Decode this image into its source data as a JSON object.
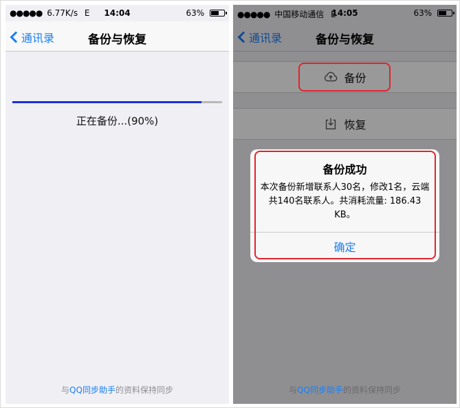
{
  "left_phone": {
    "statusbar": {
      "signal": "●●●●●",
      "speed": "6.77K/s",
      "network": "E",
      "time": "14:04",
      "battery_pct": "63%",
      "battery_level": 0.63
    },
    "nav": {
      "back_label": "通讯录",
      "title": "备份与恢复"
    },
    "progress": {
      "value": 0.9,
      "text": "正在备份...(90%)"
    },
    "footer": {
      "prefix": "与",
      "link": "QQ同步助手",
      "suffix": "的资料保持同步"
    }
  },
  "right_phone": {
    "statusbar": {
      "signal": "●●●●●",
      "carrier": "中国移动通信",
      "network": "E",
      "time": "14:05",
      "battery_pct": "63%",
      "battery_level": 0.63
    },
    "nav": {
      "back_label": "通讯录",
      "title": "备份与恢复"
    },
    "backup_label": "备份",
    "restore_label": "恢复",
    "alert": {
      "title": "备份成功",
      "message": "本次备份新增联系人30名，修改1名，云端共140名联系人。共消耗流量: 186.43 KB。",
      "button": "确定"
    },
    "footer": {
      "prefix": "与",
      "link": "QQ同步助手",
      "suffix": "的资料保持同步"
    }
  },
  "colors": {
    "accent": "#1a7ef3",
    "progress": "#1a2fd6",
    "highlight": "#e0232b"
  },
  "icons": {
    "back": "chevron-left-icon",
    "backup": "cloud-upload-icon",
    "restore": "download-icon",
    "battery": "battery-icon"
  }
}
